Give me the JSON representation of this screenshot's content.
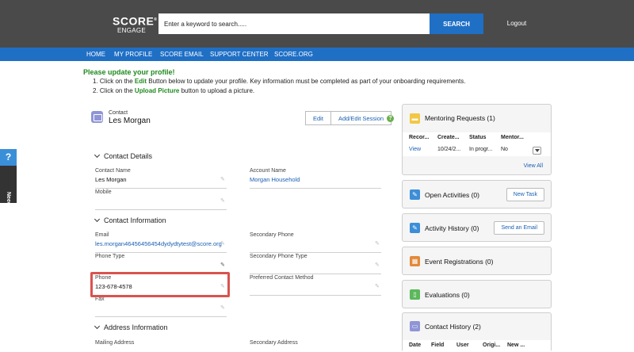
{
  "logo": {
    "line1": "SCORE",
    "line2": "ENGAGE",
    "mark": "®"
  },
  "search": {
    "placeholder": "Enter a keyword to search.....",
    "value": "",
    "button_label": "SEARCH"
  },
  "header": {
    "logout_label": "Logout"
  },
  "nav": {
    "items": [
      {
        "label": "HOME"
      },
      {
        "label": "MY PROFILE"
      },
      {
        "label": "SCORE EMAIL"
      },
      {
        "label": "SUPPORT CENTER"
      },
      {
        "label": "SCORE.ORG"
      }
    ]
  },
  "notice": {
    "heading": "Please update your profile!",
    "step1": {
      "prefix": "1. Click on the ",
      "highlight": "Edit",
      "suffix": " Button below to update your profile. Key information must be completed as part of your onboarding requirements."
    },
    "step2": {
      "prefix": "2. Click on the ",
      "highlight": "Upload Picture",
      "suffix": " button to upload a picture."
    }
  },
  "help": {
    "icon_char": "?",
    "label": "Need help?"
  },
  "record": {
    "type_label": "Contact",
    "name": "Les Morgan",
    "edit_label": "Edit",
    "session_label": "Add/Edit Session",
    "info_char": "?"
  },
  "sections": {
    "contact_details": "Contact Details",
    "contact_information": "Contact Information",
    "address_information": "Address Information"
  },
  "fields": {
    "contact_name": {
      "label": "Contact Name",
      "value": "Les Morgan"
    },
    "account_name": {
      "label": "Account Name",
      "value": "Morgan Household"
    },
    "mobile": {
      "label": "Mobile",
      "value": ""
    },
    "email": {
      "label": "Email",
      "value": "les.morgan46456456454dydydtytest@score.org"
    },
    "secondary_phone": {
      "label": "Secondary Phone",
      "value": ""
    },
    "phone_type": {
      "label": "Phone Type",
      "value": ""
    },
    "secondary_phone_type": {
      "label": "Secondary Phone Type",
      "value": ""
    },
    "phone": {
      "label": "Phone",
      "value": "123-678-4578"
    },
    "preferred_contact_method": {
      "label": "Preferred Contact Method",
      "value": ""
    },
    "fax": {
      "label": "Fax",
      "value": ""
    },
    "mailing_address": {
      "label": "Mailing Address"
    },
    "secondary_address": {
      "label": "Secondary Address"
    }
  },
  "sidebar": {
    "mentoring": {
      "title": "Mentoring Requests (1)",
      "icon": "folder-icon",
      "icon_color": "#f2c744",
      "columns": [
        "Recor...",
        "Create...",
        "Status",
        "Mentor..."
      ],
      "row": {
        "record": "View",
        "created": "10/24/2...",
        "status": "In progr...",
        "mentor": "No"
      },
      "view_all": "View All"
    },
    "open_activities": {
      "title": "Open Activities (0)",
      "button": "New Task",
      "icon": "wrench-icon",
      "icon_color": "#3d8ed8"
    },
    "activity_history": {
      "title": "Activity History (0)",
      "button": "Send an Email",
      "icon": "wrench-icon",
      "icon_color": "#3d8ed8"
    },
    "event_registrations": {
      "title": "Event Registrations (0)",
      "icon": "building-icon",
      "icon_color": "#e28a3c"
    },
    "evaluations": {
      "title": "Evaluations (0)",
      "icon": "phone-icon",
      "icon_color": "#5cb85c"
    },
    "contact_history": {
      "title": "Contact History (2)",
      "icon": "contact-card-icon",
      "icon_color": "#8f95d6",
      "columns": [
        "Date",
        "Field",
        "User",
        "Origi...",
        "New ..."
      ]
    }
  }
}
